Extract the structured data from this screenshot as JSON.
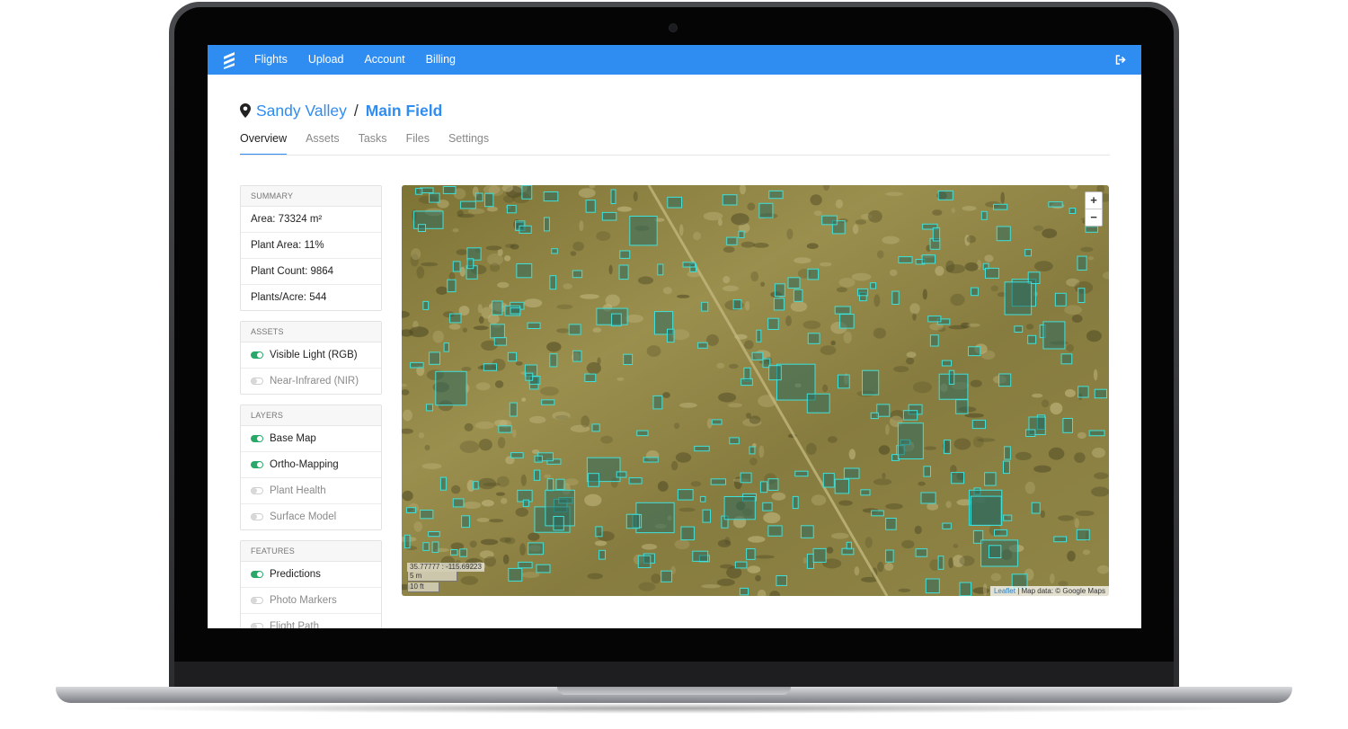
{
  "nav": {
    "links": [
      "Flights",
      "Upload",
      "Account",
      "Billing"
    ],
    "brand_color": "#2f8cf0"
  },
  "breadcrumb": {
    "parent": "Sandy Valley",
    "separator": "/",
    "current": "Main Field"
  },
  "tabs": [
    "Overview",
    "Assets",
    "Tasks",
    "Files",
    "Settings"
  ],
  "active_tab": "Overview",
  "sidebar": {
    "summary": {
      "title": "SUMMARY",
      "area": "Area: 73324 m²",
      "plant_area": "Plant Area: 11%",
      "plant_count": "Plant Count: 9864",
      "plants_per_acre": "Plants/Acre: 544"
    },
    "assets": {
      "title": "ASSETS",
      "items": [
        {
          "label": "Visible Light (RGB)",
          "on": true
        },
        {
          "label": "Near-Infrared (NIR)",
          "on": false
        }
      ]
    },
    "layers": {
      "title": "LAYERS",
      "items": [
        {
          "label": "Base Map",
          "on": true
        },
        {
          "label": "Ortho-Mapping",
          "on": true
        },
        {
          "label": "Plant Health",
          "on": false
        },
        {
          "label": "Surface Model",
          "on": false
        }
      ]
    },
    "features": {
      "title": "FEATURES",
      "items": [
        {
          "label": "Predictions",
          "on": true
        },
        {
          "label": "Photo Markers",
          "on": false
        },
        {
          "label": "Flight Path",
          "on": false
        }
      ]
    }
  },
  "map": {
    "zoom_in": "+",
    "zoom_out": "−",
    "coordinates": "35.77777 : -115.69223",
    "scale_metric": "5 m",
    "scale_imperial": "10 ft",
    "attribution_link": "Leaflet",
    "attribution_text": " | Map data: © Google Maps",
    "box_color": "#3fe0da"
  }
}
